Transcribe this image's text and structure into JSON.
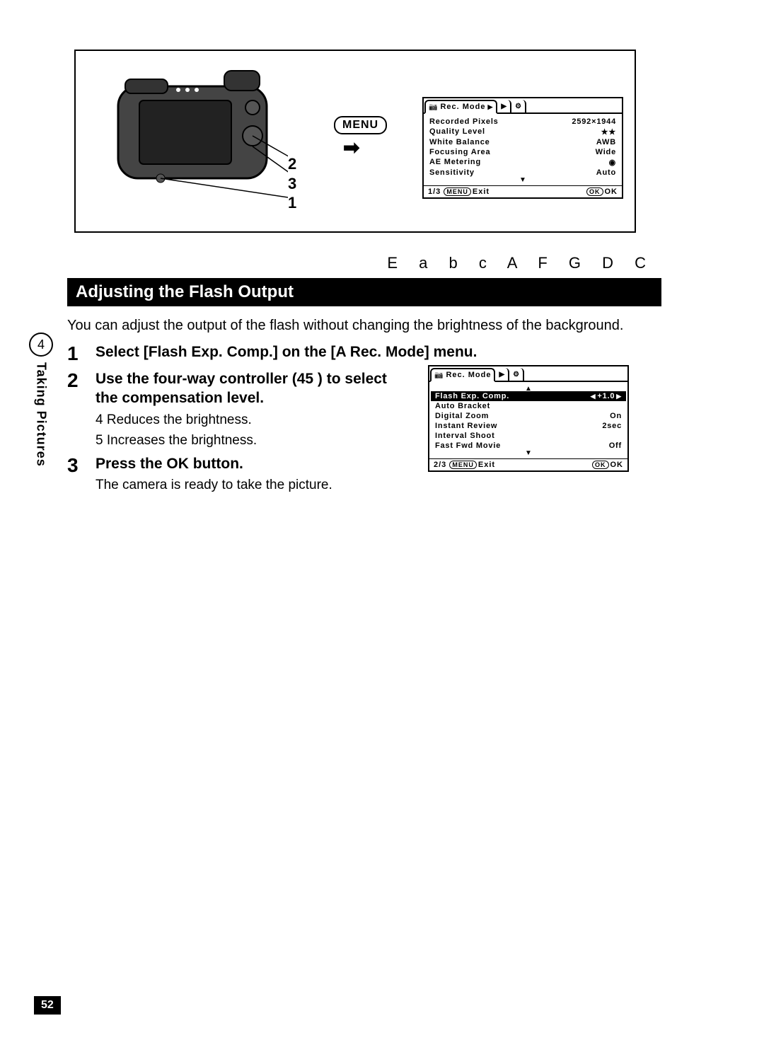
{
  "sideTab": {
    "chapter": "4",
    "label": "Taking Pictures"
  },
  "pageNumber": "52",
  "diagram": {
    "menuButton": "MENU",
    "numbers": [
      "2",
      "3",
      "1"
    ]
  },
  "menuScreen1": {
    "title": "Rec. Mode",
    "rows": [
      {
        "label": "Recorded Pixels",
        "value": "2592×1944"
      },
      {
        "label": "Quality Level",
        "value": "★★"
      },
      {
        "label": "White Balance",
        "value": "AWB"
      },
      {
        "label": "Focusing Area",
        "value": "Wide"
      },
      {
        "label": "AE Metering",
        "value": "◉"
      },
      {
        "label": "Sensitivity",
        "value": "Auto"
      }
    ],
    "footerLeft": "1/3",
    "footerExit": "Exit",
    "footerOK": "OK",
    "menuPill": "MENU",
    "okPill": "OK"
  },
  "modeRow": "E   a  b  c   A  F   G  D  C",
  "sectionTitle": "Adjusting the Flash Output",
  "intro": "You can adjust the output of the flash without changing the brightness of the background.",
  "steps": [
    {
      "num": "1",
      "title_a": "Select [Flash Exp. Comp.] on the [A",
      "title_b": " Rec. Mode] menu."
    },
    {
      "num": "2",
      "title": "Use the four-way controller (45  ) to select the compensation level.",
      "sub": [
        "4  Reduces the brightness.",
        "5  Increases the brightness."
      ]
    },
    {
      "num": "3",
      "title": "Press the OK button.",
      "sub": [
        "The camera is ready to take the picture."
      ]
    }
  ],
  "menuScreen2": {
    "title": "Rec. Mode",
    "rows": [
      {
        "label": "Flash Exp. Comp.",
        "value": "+1.0",
        "highlight": true,
        "arrows": true
      },
      {
        "label": "Auto Bracket",
        "value": ""
      },
      {
        "label": "Digital Zoom",
        "value": "On"
      },
      {
        "label": "Instant Review",
        "value": "2sec"
      },
      {
        "label": "Interval Shoot",
        "value": ""
      },
      {
        "label": "Fast Fwd Movie",
        "value": "Off"
      }
    ],
    "footerLeft": "2/3",
    "footerExit": "Exit",
    "footerOK": "OK",
    "menuPill": "MENU",
    "okPill": "OK"
  }
}
